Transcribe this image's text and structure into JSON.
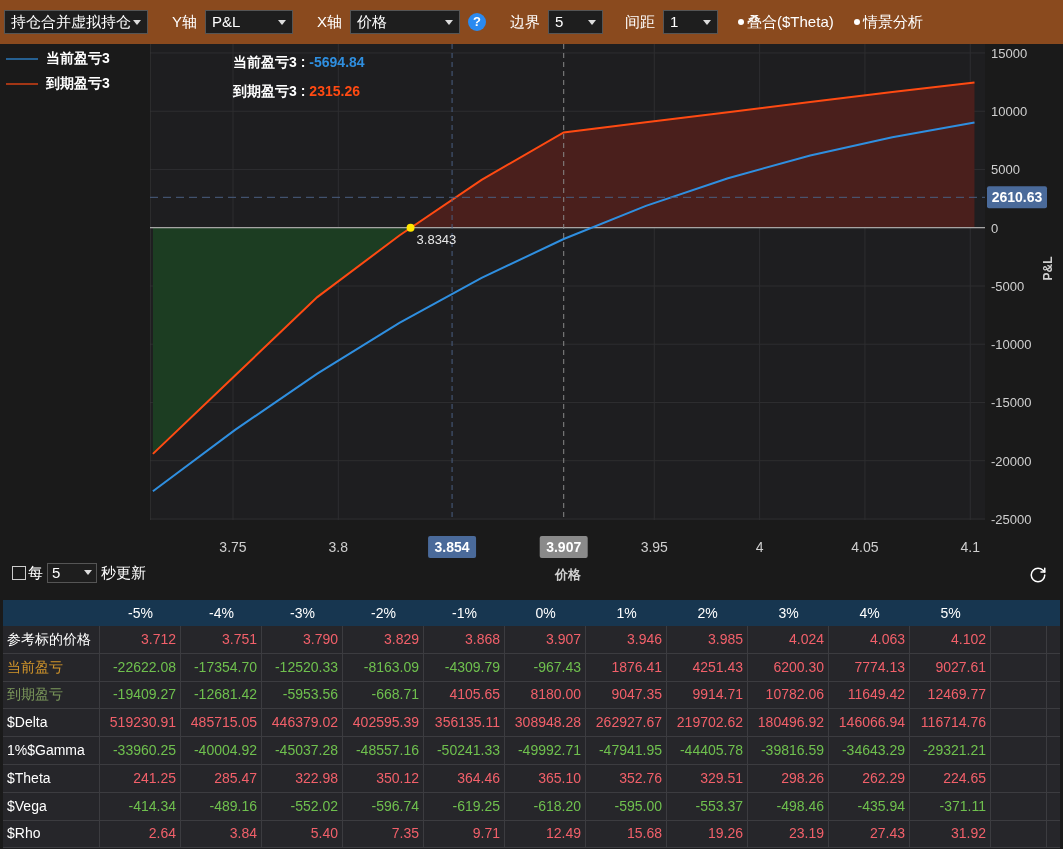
{
  "toolbar": {
    "position_dropdown": {
      "value": "持仓合并虚拟持仓"
    },
    "y_axis": {
      "label": "Y轴",
      "value": "P&L"
    },
    "x_axis": {
      "label": "X轴",
      "value": "价格"
    },
    "help": "?",
    "boundary": {
      "label": "边界",
      "value": "5"
    },
    "spacing": {
      "label": "间距",
      "value": "1"
    },
    "options": [
      {
        "label": "叠合($Theta)"
      },
      {
        "label": "情景分析"
      }
    ]
  },
  "readouts": [
    {
      "label": "当前盈亏3 :",
      "value": "-5694.84"
    },
    {
      "label": "到期盈亏3 :",
      "value": "2315.26"
    }
  ],
  "crosshair": {
    "point_label": "3.8343"
  },
  "chart_data": {
    "type": "line",
    "xlabel": "价格",
    "ylabel": "P&L",
    "x": [
      3.712,
      3.751,
      3.79,
      3.829,
      3.868,
      3.907,
      3.946,
      3.985,
      4.024,
      4.063,
      4.102
    ],
    "grid": true,
    "ref_lines": [
      {
        "axis": "x",
        "value": 3.854,
        "label": "3.854"
      },
      {
        "axis": "x",
        "value": 3.907,
        "label": "3.907"
      },
      {
        "axis": "y",
        "value": 2610.63,
        "label": "2610.63"
      }
    ],
    "series": [
      {
        "name": "当前盈亏3",
        "color": "#2f8fe0",
        "values": [
          -22622,
          -17355,
          -12520,
          -8163,
          -4310,
          -967,
          1876,
          4251,
          6200,
          7774,
          9028
        ]
      },
      {
        "name": "到期盈亏3",
        "color": "#ff4a12",
        "values": [
          -19409,
          -12681,
          -5954,
          -669,
          4106,
          8180,
          9047,
          9915,
          10782,
          11649,
          12470
        ]
      }
    ],
    "xlim": [
      3.7106,
      4.107
    ],
    "ylim": [
      -25086,
      15770
    ],
    "xticks": [
      3.75,
      3.8,
      3.95,
      4,
      4.05,
      4.1
    ],
    "yticks": [
      15000,
      10000,
      5000,
      0,
      -5000,
      -10000,
      -15000,
      -20000,
      -25000
    ]
  },
  "auto_refresh": {
    "checked": false,
    "before": "每",
    "interval": "5",
    "after": "秒更新"
  },
  "table": {
    "columns": [
      "-5%",
      "-4%",
      "-3%",
      "-2%",
      "-1%",
      "0%",
      "1%",
      "2%",
      "3%",
      "4%",
      "5%"
    ],
    "rows": [
      {
        "label": "参考标的价格",
        "color": "#ffffff",
        "cells": [
          "3.712",
          "3.751",
          "3.790",
          "3.829",
          "3.868",
          "3.907",
          "3.946",
          "3.985",
          "4.024",
          "4.063",
          "4.102"
        ]
      },
      {
        "label": "当前盈亏",
        "color": "#d4962a",
        "cells": [
          "-22622.08",
          "-17354.70",
          "-12520.33",
          "-8163.09",
          "-4309.79",
          "-967.43",
          "1876.41",
          "4251.43",
          "6200.30",
          "7774.13",
          "9027.61"
        ]
      },
      {
        "label": "到期盈亏",
        "color": "#7d9a5c",
        "cells": [
          "-19409.27",
          "-12681.42",
          "-5953.56",
          "-668.71",
          "4105.65",
          "8180.00",
          "9047.35",
          "9914.71",
          "10782.06",
          "11649.42",
          "12469.77"
        ]
      },
      {
        "label": "$Delta",
        "color": "#ffffff",
        "cells": [
          "519230.91",
          "485715.05",
          "446379.02",
          "402595.39",
          "356135.11",
          "308948.28",
          "262927.67",
          "219702.62",
          "180496.92",
          "146066.94",
          "116714.76"
        ]
      },
      {
        "label": "1%$Gamma",
        "color": "#ffffff",
        "cells": [
          "-33960.25",
          "-40004.92",
          "-45037.28",
          "-48557.16",
          "-50241.33",
          "-49992.71",
          "-47941.95",
          "-44405.78",
          "-39816.59",
          "-34643.29",
          "-29321.21"
        ]
      },
      {
        "label": "$Theta",
        "color": "#ffffff",
        "cells": [
          "241.25",
          "285.47",
          "322.98",
          "350.12",
          "364.46",
          "365.10",
          "352.76",
          "329.51",
          "298.26",
          "262.29",
          "224.65"
        ]
      },
      {
        "label": "$Vega",
        "color": "#ffffff",
        "cells": [
          "-414.34",
          "-489.16",
          "-552.02",
          "-596.74",
          "-619.25",
          "-618.20",
          "-595.00",
          "-553.37",
          "-498.46",
          "-435.94",
          "-371.11"
        ]
      },
      {
        "label": "$Rho",
        "color": "#ffffff",
        "cells": [
          "2.64",
          "3.84",
          "5.40",
          "7.35",
          "9.71",
          "12.49",
          "15.68",
          "19.26",
          "23.19",
          "27.43",
          "31.92"
        ]
      }
    ]
  }
}
